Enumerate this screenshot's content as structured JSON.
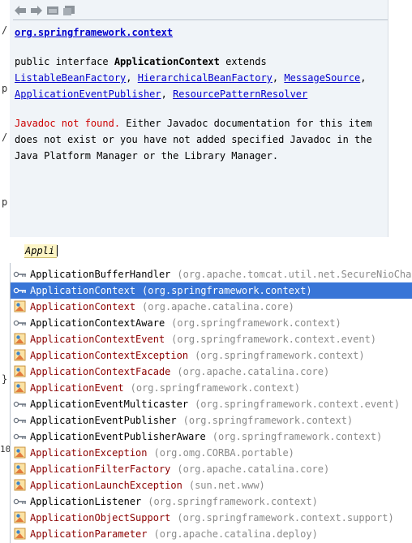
{
  "editor": {
    "gutter_marks": [
      "/",
      "p",
      "/",
      "p",
      "}",
      "10"
    ]
  },
  "doc": {
    "package_link": "org.springframework.context",
    "decl_prefix": "public interface ",
    "decl_name": "ApplicationContext",
    "decl_extends": " extends",
    "supertypes": [
      "ListableBeanFactory",
      "HierarchicalBeanFactory",
      "MessageSource",
      "ApplicationEventPublisher",
      "ResourcePatternResolver"
    ],
    "not_found": "Javadoc not found.",
    "message_line1": " Either Javadoc documentation for this item",
    "message_line2": "does not exist or you have not added specified Javadoc in the",
    "message_line3": "Java Platform Manager or the Library Manager."
  },
  "search": {
    "value": "Appli"
  },
  "completions": [
    {
      "name": "ApplicationBufferHandler",
      "pkg": "(org.apache.tomcat.util.net.SecureNioChanne",
      "kind": "interface",
      "red": false
    },
    {
      "name": "ApplicationContext",
      "pkg": "(org.springframework.context)",
      "kind": "interface",
      "red": false,
      "selected": true
    },
    {
      "name": "ApplicationContext",
      "pkg": "(org.apache.catalina.core)",
      "kind": "class",
      "red": true
    },
    {
      "name": "ApplicationContextAware",
      "pkg": "(org.springframework.context)",
      "kind": "interface",
      "red": false
    },
    {
      "name": "ApplicationContextEvent",
      "pkg": "(org.springframework.context.event)",
      "kind": "class",
      "red": true
    },
    {
      "name": "ApplicationContextException",
      "pkg": "(org.springframework.context)",
      "kind": "class",
      "red": true
    },
    {
      "name": "ApplicationContextFacade",
      "pkg": "(org.apache.catalina.core)",
      "kind": "class",
      "red": true
    },
    {
      "name": "ApplicationEvent",
      "pkg": "(org.springframework.context)",
      "kind": "class",
      "red": true
    },
    {
      "name": "ApplicationEventMulticaster",
      "pkg": "(org.springframework.context.event)",
      "kind": "interface",
      "red": false
    },
    {
      "name": "ApplicationEventPublisher",
      "pkg": "(org.springframework.context)",
      "kind": "interface",
      "red": false
    },
    {
      "name": "ApplicationEventPublisherAware",
      "pkg": "(org.springframework.context)",
      "kind": "interface",
      "red": false
    },
    {
      "name": "ApplicationException",
      "pkg": "(org.omg.CORBA.portable)",
      "kind": "class",
      "red": true
    },
    {
      "name": "ApplicationFilterFactory",
      "pkg": "(org.apache.catalina.core)",
      "kind": "class",
      "red": true
    },
    {
      "name": "ApplicationLaunchException",
      "pkg": "(sun.net.www)",
      "kind": "class",
      "red": true
    },
    {
      "name": "ApplicationListener",
      "pkg": "(org.springframework.context)",
      "kind": "interface",
      "red": false
    },
    {
      "name": "ApplicationObjectSupport",
      "pkg": "(org.springframework.context.support)",
      "kind": "class",
      "red": true
    },
    {
      "name": "ApplicationParameter",
      "pkg": "(org.apache.catalina.deploy)",
      "kind": "class",
      "red": true
    }
  ]
}
